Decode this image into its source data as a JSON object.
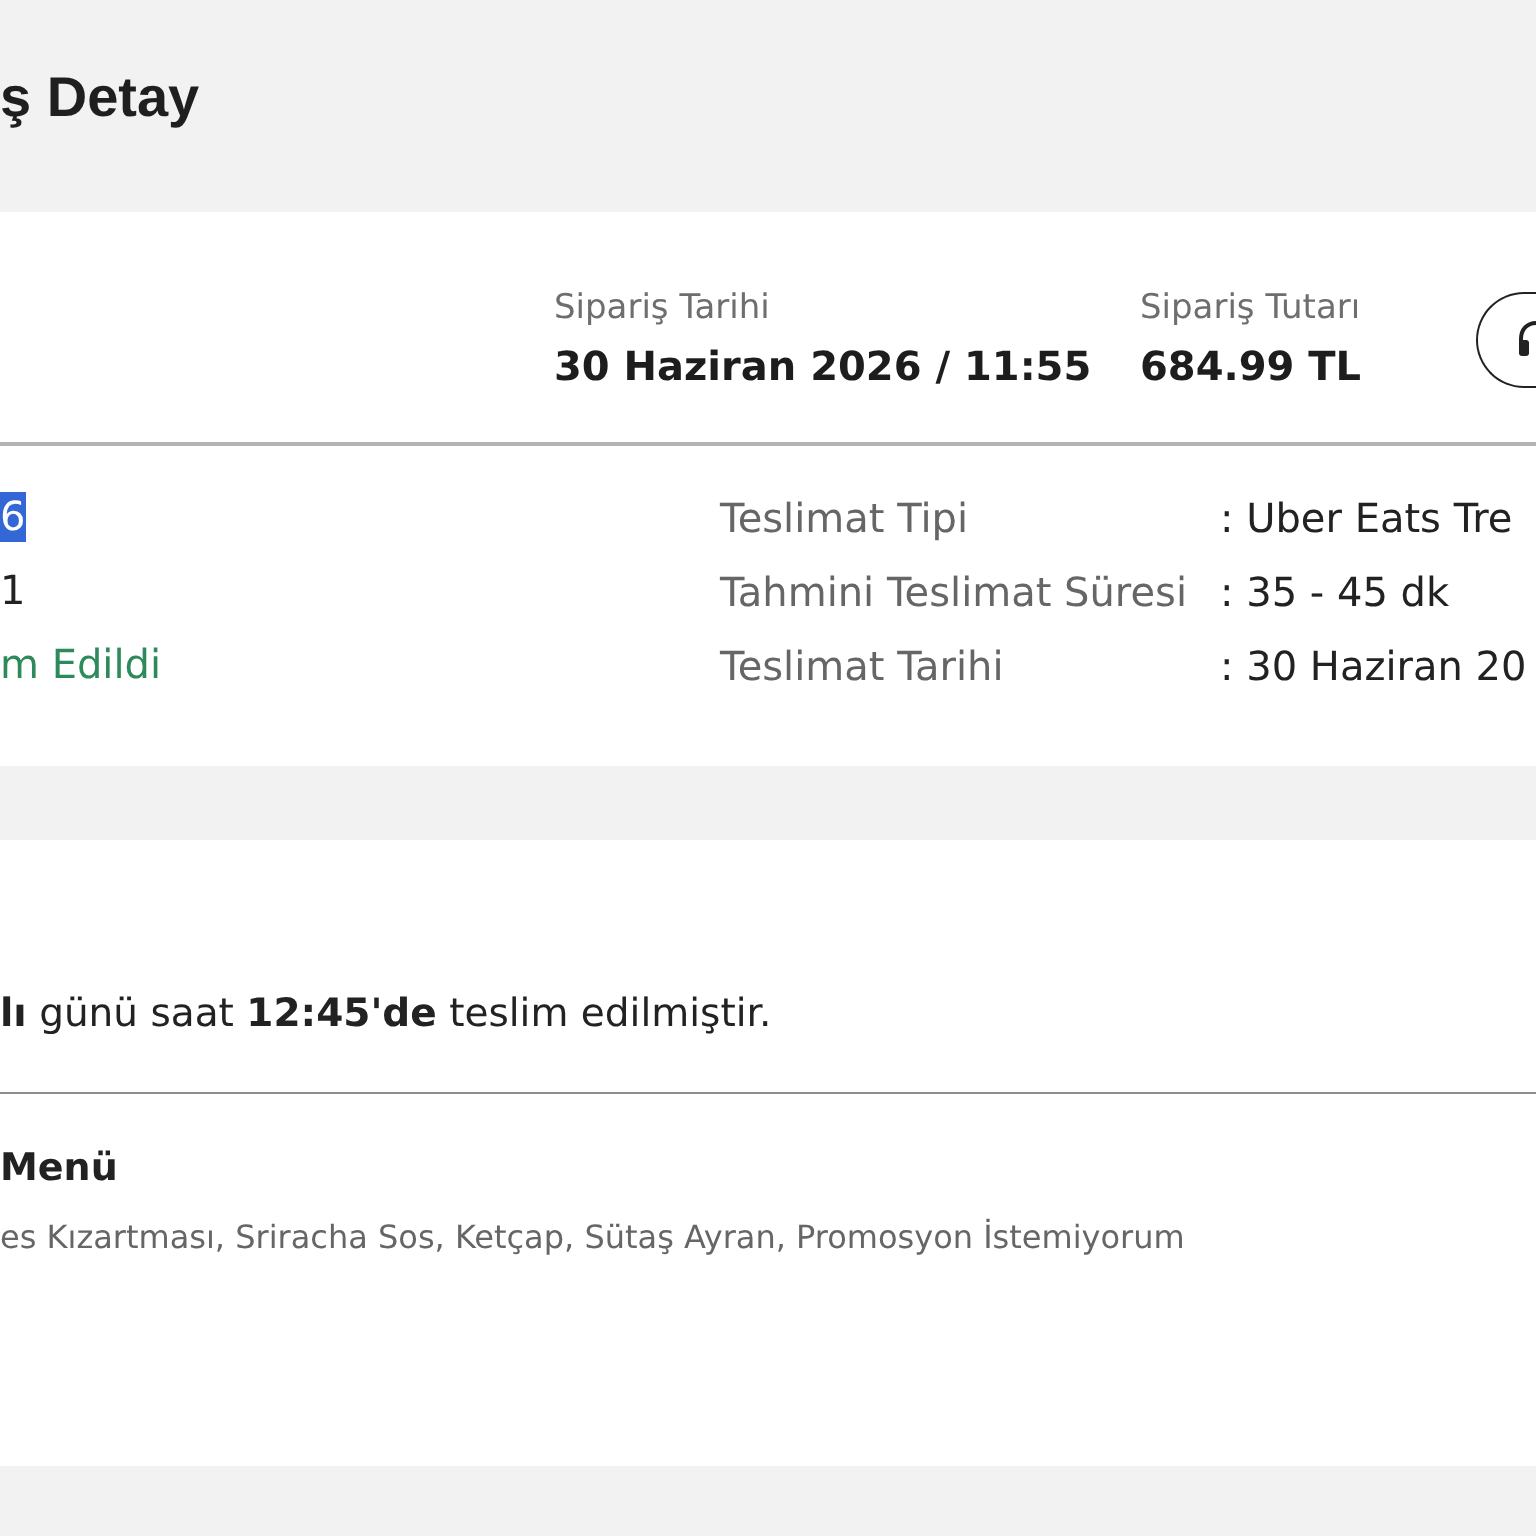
{
  "page": {
    "title": "ş Detay"
  },
  "summary": {
    "fields": [
      {
        "label": "Sipariş Tarihi",
        "value": "30 Haziran 2026 / 11:55"
      },
      {
        "label": "Sipariş Tutarı",
        "value": "684.99 TL"
      }
    ]
  },
  "order_info": [
    {
      "value": "6",
      "kind": "text",
      "highlighted": true
    },
    {
      "value": "1",
      "kind": "text",
      "highlighted": false
    },
    {
      "value": "m Edildi",
      "kind": "status",
      "highlighted": false
    }
  ],
  "delivery_info": [
    {
      "label": "Teslimat Tipi",
      "value": ": Uber Eats Tre"
    },
    {
      "label": "Tahmini Teslimat Süresi",
      "value": ": 35 - 45 dk"
    },
    {
      "label": "Teslimat Tarihi",
      "value": ": 30 Haziran 20"
    }
  ],
  "delivery": {
    "message": "**lı** günü saat **12:45'de** teslim edilmiştir."
  },
  "items": [
    {
      "name": "Menü",
      "options": "es Kızartması, Sriracha Sos, Ketçap, Sütaş Ayran, Promosyon İstemiyorum"
    }
  ]
}
